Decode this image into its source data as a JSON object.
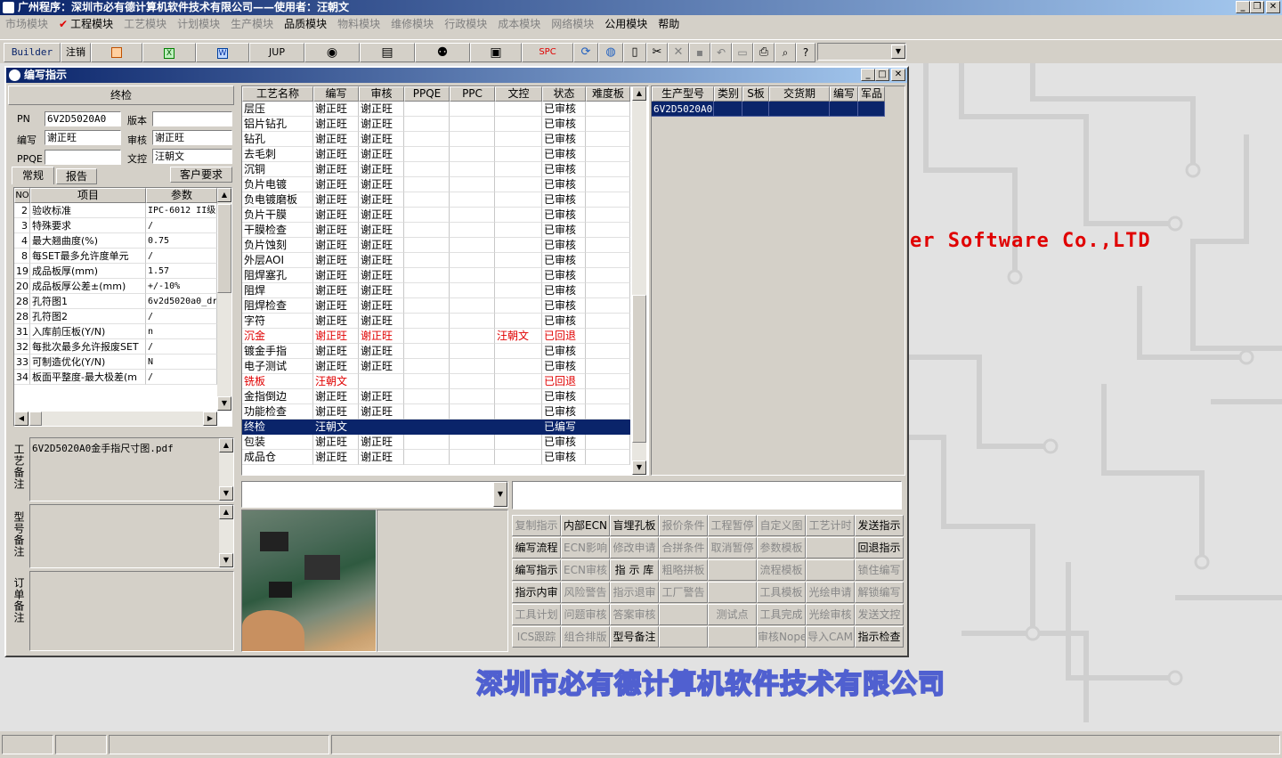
{
  "app": {
    "title": "广州程序：深圳市必有德计算机软件技术有限公司——使用者：汪朝文",
    "menus": [
      {
        "label": "市场模块",
        "active": false
      },
      {
        "label": "工程模块",
        "active": true
      },
      {
        "label": "工艺模块",
        "active": false
      },
      {
        "label": "计划模块",
        "active": false
      },
      {
        "label": "生产模块",
        "active": false
      },
      {
        "label": "品质模块",
        "active": true
      },
      {
        "label": "物料模块",
        "active": false
      },
      {
        "label": "维修模块",
        "active": false
      },
      {
        "label": "行政模块",
        "active": false
      },
      {
        "label": "成本模块",
        "active": false
      },
      {
        "label": "网络模块",
        "active": false
      },
      {
        "label": "公用模块",
        "active": true
      },
      {
        "label": "帮助",
        "active": true
      }
    ],
    "toolbar": {
      "builder": "Builder",
      "logout": "注销",
      "jup": "JUP",
      "spc": "SPC"
    },
    "background": {
      "brand_en": "er Software Co.,LTD",
      "brand_cn": "深圳市必有德计算机软件技术有限公司"
    }
  },
  "window": {
    "title": "编写指示",
    "step_title": "终检",
    "pn_label": "PN",
    "pn_value": "6V2D5020A0",
    "version_label": "版本",
    "version_value": "",
    "writer_label": "编写",
    "writer_value": "谢正旺",
    "reviewer_label": "审核",
    "reviewer_value": "谢正旺",
    "ppqe_label": "PPQE",
    "ppqe_value": "",
    "doc_ctrl_label": "文控",
    "doc_ctrl_value": "汪朝文",
    "tabs": [
      "常规",
      "报告",
      "客户要求"
    ],
    "param_headers": [
      "NO",
      "项目",
      "参数"
    ],
    "params": [
      {
        "no": "2",
        "item": "验收标准",
        "value": "IPC-6012 II级"
      },
      {
        "no": "3",
        "item": "特殊要求",
        "value": "/"
      },
      {
        "no": "4",
        "item": "最大翘曲度(%)",
        "value": "0.75"
      },
      {
        "no": "8",
        "item": "每SET最多允许度单元",
        "value": "/"
      },
      {
        "no": "19",
        "item": "成品板厚(mm)",
        "value": "1.57"
      },
      {
        "no": "20",
        "item": "成品板厚公差±(mm)",
        "value": "+/-10%"
      },
      {
        "no": "28",
        "item": "孔符图1",
        "value": "6v2d5020a0_dr"
      },
      {
        "no": "28",
        "item": "孔符图2",
        "value": "/"
      },
      {
        "no": "31",
        "item": "入库前压板(Y/N)",
        "value": "n"
      },
      {
        "no": "32",
        "item": "每批次最多允许报废SET",
        "value": "/"
      },
      {
        "no": "33",
        "item": "可制造优化(Y/N)",
        "value": "N"
      },
      {
        "no": "34",
        "item": "板面平整度-最大极差(m",
        "value": "/"
      }
    ],
    "note_labels": {
      "process": "工艺备注",
      "model": "型号备注",
      "order": "订单备注"
    },
    "process_note": "6V2D5020A0金手指尺寸图.pdf",
    "process_headers": [
      "工艺名称",
      "编写",
      "审核",
      "PPQE",
      "PPC",
      "文控",
      "状态",
      "难度板"
    ],
    "processes": [
      {
        "name": "层压",
        "writer": "谢正旺",
        "reviewer": "谢正旺",
        "ppqe": "",
        "ppc": "",
        "doc": "",
        "status": "已审核",
        "level": "",
        "style": "normal"
      },
      {
        "name": "铝片钻孔",
        "writer": "谢正旺",
        "reviewer": "谢正旺",
        "ppqe": "",
        "ppc": "",
        "doc": "",
        "status": "已审核",
        "level": "",
        "style": "normal"
      },
      {
        "name": "钻孔",
        "writer": "谢正旺",
        "reviewer": "谢正旺",
        "ppqe": "",
        "ppc": "",
        "doc": "",
        "status": "已审核",
        "level": "",
        "style": "normal"
      },
      {
        "name": "去毛刺",
        "writer": "谢正旺",
        "reviewer": "谢正旺",
        "ppqe": "",
        "ppc": "",
        "doc": "",
        "status": "已审核",
        "level": "",
        "style": "normal"
      },
      {
        "name": "沉铜",
        "writer": "谢正旺",
        "reviewer": "谢正旺",
        "ppqe": "",
        "ppc": "",
        "doc": "",
        "status": "已审核",
        "level": "",
        "style": "normal"
      },
      {
        "name": "负片电镀",
        "writer": "谢正旺",
        "reviewer": "谢正旺",
        "ppqe": "",
        "ppc": "",
        "doc": "",
        "status": "已审核",
        "level": "",
        "style": "normal"
      },
      {
        "name": "负电镀磨板",
        "writer": "谢正旺",
        "reviewer": "谢正旺",
        "ppqe": "",
        "ppc": "",
        "doc": "",
        "status": "已审核",
        "level": "",
        "style": "normal"
      },
      {
        "name": "负片干膜",
        "writer": "谢正旺",
        "reviewer": "谢正旺",
        "ppqe": "",
        "ppc": "",
        "doc": "",
        "status": "已审核",
        "level": "",
        "style": "normal"
      },
      {
        "name": "干膜检查",
        "writer": "谢正旺",
        "reviewer": "谢正旺",
        "ppqe": "",
        "ppc": "",
        "doc": "",
        "status": "已审核",
        "level": "",
        "style": "normal"
      },
      {
        "name": "负片蚀刻",
        "writer": "谢正旺",
        "reviewer": "谢正旺",
        "ppqe": "",
        "ppc": "",
        "doc": "",
        "status": "已审核",
        "level": "",
        "style": "normal"
      },
      {
        "name": "外层AOI",
        "writer": "谢正旺",
        "reviewer": "谢正旺",
        "ppqe": "",
        "ppc": "",
        "doc": "",
        "status": "已审核",
        "level": "",
        "style": "normal"
      },
      {
        "name": "阻焊塞孔",
        "writer": "谢正旺",
        "reviewer": "谢正旺",
        "ppqe": "",
        "ppc": "",
        "doc": "",
        "status": "已审核",
        "level": "",
        "style": "normal"
      },
      {
        "name": "阻焊",
        "writer": "谢正旺",
        "reviewer": "谢正旺",
        "ppqe": "",
        "ppc": "",
        "doc": "",
        "status": "已审核",
        "level": "",
        "style": "normal"
      },
      {
        "name": "阻焊检查",
        "writer": "谢正旺",
        "reviewer": "谢正旺",
        "ppqe": "",
        "ppc": "",
        "doc": "",
        "status": "已审核",
        "level": "",
        "style": "normal"
      },
      {
        "name": "字符",
        "writer": "谢正旺",
        "reviewer": "谢正旺",
        "ppqe": "",
        "ppc": "",
        "doc": "",
        "status": "已审核",
        "level": "",
        "style": "normal"
      },
      {
        "name": "沉金",
        "writer": "谢正旺",
        "reviewer": "谢正旺",
        "ppqe": "",
        "ppc": "",
        "doc": "汪朝文",
        "status": "已回退",
        "level": "",
        "style": "red"
      },
      {
        "name": "镀金手指",
        "writer": "谢正旺",
        "reviewer": "谢正旺",
        "ppqe": "",
        "ppc": "",
        "doc": "",
        "status": "已审核",
        "level": "",
        "style": "normal"
      },
      {
        "name": "电子测试",
        "writer": "谢正旺",
        "reviewer": "谢正旺",
        "ppqe": "",
        "ppc": "",
        "doc": "",
        "status": "已审核",
        "level": "",
        "style": "normal"
      },
      {
        "name": "铣板",
        "writer": "汪朝文",
        "reviewer": "",
        "ppqe": "",
        "ppc": "",
        "doc": "",
        "status": "已回退",
        "level": "",
        "style": "red"
      },
      {
        "name": "金指倒边",
        "writer": "谢正旺",
        "reviewer": "谢正旺",
        "ppqe": "",
        "ppc": "",
        "doc": "",
        "status": "已审核",
        "level": "",
        "style": "normal"
      },
      {
        "name": "功能检查",
        "writer": "谢正旺",
        "reviewer": "谢正旺",
        "ppqe": "",
        "ppc": "",
        "doc": "",
        "status": "已审核",
        "level": "",
        "style": "normal"
      },
      {
        "name": "终检",
        "writer": "汪朝文",
        "reviewer": "",
        "ppqe": "",
        "ppc": "",
        "doc": "",
        "status": "已编写",
        "level": "",
        "style": "selected"
      },
      {
        "name": "包装",
        "writer": "谢正旺",
        "reviewer": "谢正旺",
        "ppqe": "",
        "ppc": "",
        "doc": "",
        "status": "已审核",
        "level": "",
        "style": "normal"
      },
      {
        "name": "成品仓",
        "writer": "谢正旺",
        "reviewer": "谢正旺",
        "ppqe": "",
        "ppc": "",
        "doc": "",
        "status": "已审核",
        "level": "",
        "style": "normal"
      }
    ],
    "model_headers": [
      "生产型号",
      "类别",
      "S板",
      "交货期",
      "编写",
      "军品"
    ],
    "models": [
      {
        "model": "6V2D5020A0",
        "category": "",
        "s_board": "",
        "delivery": "",
        "writer": "",
        "military": ""
      }
    ],
    "buttons": [
      [
        {
          "label": "复制指示",
          "enabled": false
        },
        {
          "label": "内部ECN",
          "enabled": true
        },
        {
          "label": "盲埋孔板",
          "enabled": true
        },
        {
          "label": "报价条件",
          "enabled": false
        },
        {
          "label": "工程暂停",
          "enabled": false
        },
        {
          "label": "自定义图",
          "enabled": false
        },
        {
          "label": "工艺计时",
          "enabled": false
        },
        {
          "label": "发送指示",
          "enabled": true
        }
      ],
      [
        {
          "label": "编写流程",
          "enabled": true
        },
        {
          "label": "ECN影响",
          "enabled": false
        },
        {
          "label": "修改申请",
          "enabled": false
        },
        {
          "label": "合拼条件",
          "enabled": false
        },
        {
          "label": "取消暂停",
          "enabled": false
        },
        {
          "label": "参数模板",
          "enabled": false
        },
        {
          "label": "",
          "enabled": false
        },
        {
          "label": "回退指示",
          "enabled": true
        }
      ],
      [
        {
          "label": "编写指示",
          "enabled": true
        },
        {
          "label": "ECN审核",
          "enabled": false
        },
        {
          "label": "指 示 库",
          "enabled": true
        },
        {
          "label": "粗略拼板",
          "enabled": false
        },
        {
          "label": "",
          "enabled": false
        },
        {
          "label": "流程模板",
          "enabled": false
        },
        {
          "label": "",
          "enabled": false
        },
        {
          "label": "锁住编写",
          "enabled": false
        }
      ],
      [
        {
          "label": "指示内审",
          "enabled": true
        },
        {
          "label": "风险警告",
          "enabled": false
        },
        {
          "label": "指示退审",
          "enabled": false
        },
        {
          "label": "工厂警告",
          "enabled": false
        },
        {
          "label": "",
          "enabled": false
        },
        {
          "label": "工具模板",
          "enabled": false
        },
        {
          "label": "光绘申请",
          "enabled": false
        },
        {
          "label": "解锁编写",
          "enabled": false
        }
      ],
      [
        {
          "label": "工具计划",
          "enabled": false
        },
        {
          "label": "问题审核",
          "enabled": false
        },
        {
          "label": "答案审核",
          "enabled": false
        },
        {
          "label": "",
          "enabled": false
        },
        {
          "label": "测试点",
          "enabled": false
        },
        {
          "label": "工具完成",
          "enabled": false
        },
        {
          "label": "光绘审核",
          "enabled": false
        },
        {
          "label": "发送文控",
          "enabled": false
        }
      ],
      [
        {
          "label": "ICS跟踪",
          "enabled": false
        },
        {
          "label": "组合排版",
          "enabled": false
        },
        {
          "label": "型号备注",
          "enabled": true
        },
        {
          "label": "",
          "enabled": false
        },
        {
          "label": "",
          "enabled": false
        },
        {
          "label": "审核Nope",
          "enabled": false
        },
        {
          "label": "导入CAM",
          "enabled": false
        },
        {
          "label": "指示检查",
          "enabled": true
        }
      ]
    ]
  }
}
